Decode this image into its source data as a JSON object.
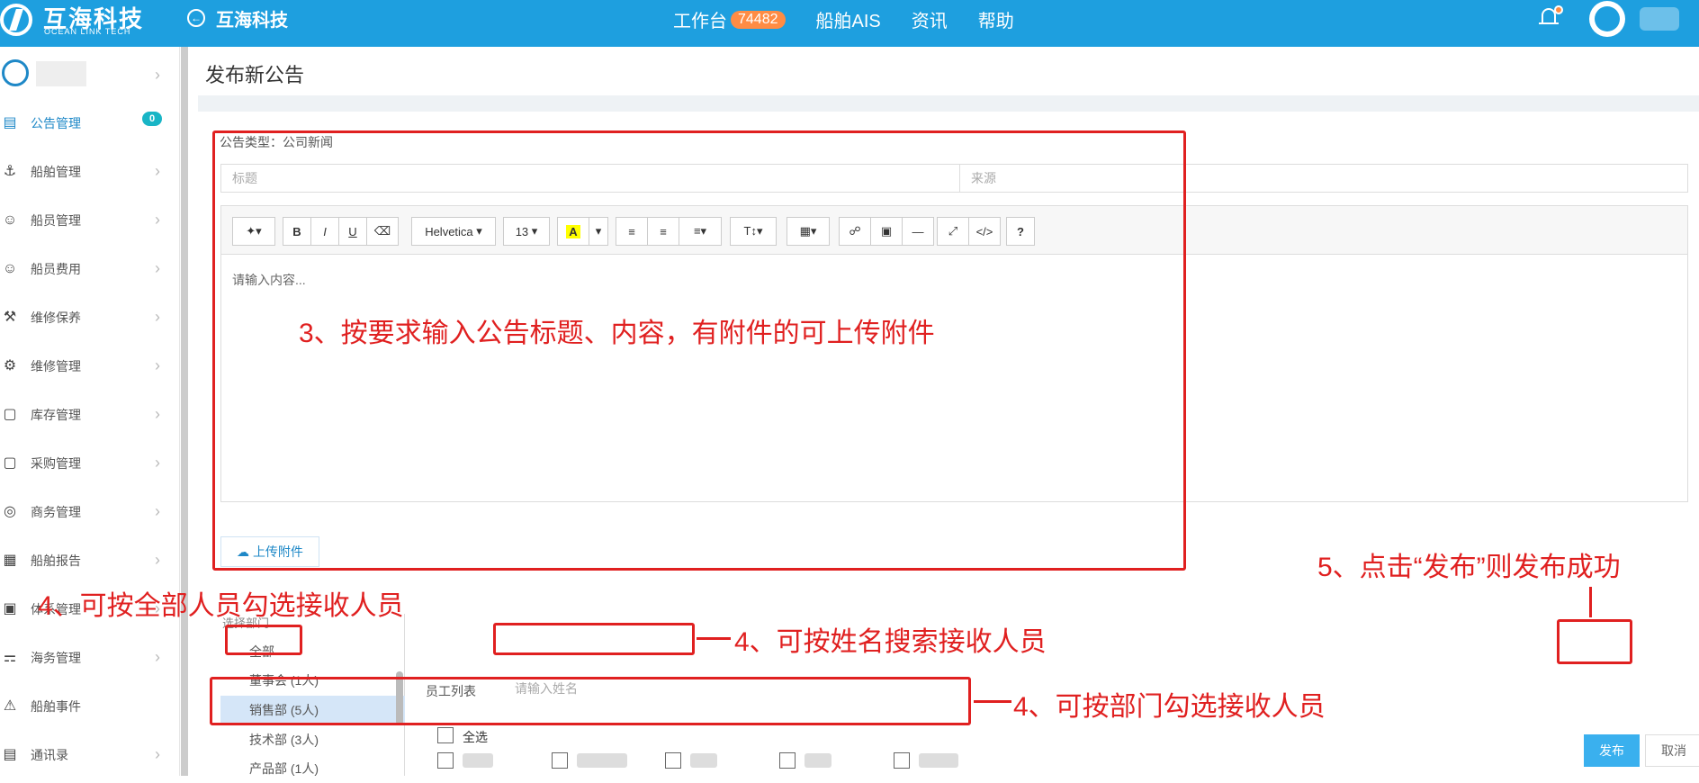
{
  "header": {
    "logo_cn": "互海科技",
    "logo_en": "OCEAN LINK TECH",
    "back_text": "互海科技",
    "nav": [
      {
        "label": "工作台",
        "badge": "74482"
      },
      {
        "label": "船舶AIS"
      },
      {
        "label": "资讯"
      },
      {
        "label": "帮助"
      }
    ]
  },
  "sidebar": {
    "items": [
      {
        "label": "公告管理",
        "badge": "0"
      },
      {
        "label": "船舶管理"
      },
      {
        "label": "船员管理"
      },
      {
        "label": "船员费用"
      },
      {
        "label": "维修保养"
      },
      {
        "label": "维修管理"
      },
      {
        "label": "库存管理"
      },
      {
        "label": "采购管理"
      },
      {
        "label": "商务管理"
      },
      {
        "label": "船舶报告"
      },
      {
        "label": "体系管理"
      },
      {
        "label": "海务管理"
      },
      {
        "label": "船舶事件"
      },
      {
        "label": "通讯录"
      }
    ]
  },
  "page": {
    "title": "发布新公告",
    "type_label": "公告类型：公司新闻",
    "title_placeholder": "标题",
    "source_placeholder": "来源",
    "editor": {
      "font_family": "Helvetica",
      "font_size": "13",
      "placeholder": "请输入内容..."
    },
    "upload_label": "上传附件",
    "dept_title": "选择部门",
    "departments": [
      "全部",
      "董事会 (1人)",
      "销售部 (5人)",
      "技术部 (3人)",
      "产品部 (1人)"
    ],
    "employee_label": "员工列表",
    "employee_placeholder": "请输入姓名",
    "select_all": "全选",
    "publish_label": "发布",
    "cancel_label": "取消"
  },
  "annotations": {
    "a3": "3、按要求输入公告标题、内容，有附件的可上传附件",
    "a4_all": "4、可按全部人员勾选接收人员",
    "a4_name": "4、可按姓名搜索接收人员",
    "a4_dept": "4、可按部门勾选接收人员",
    "a5": "5、点击“发布”则发布成功",
    "color": "#e02020"
  }
}
